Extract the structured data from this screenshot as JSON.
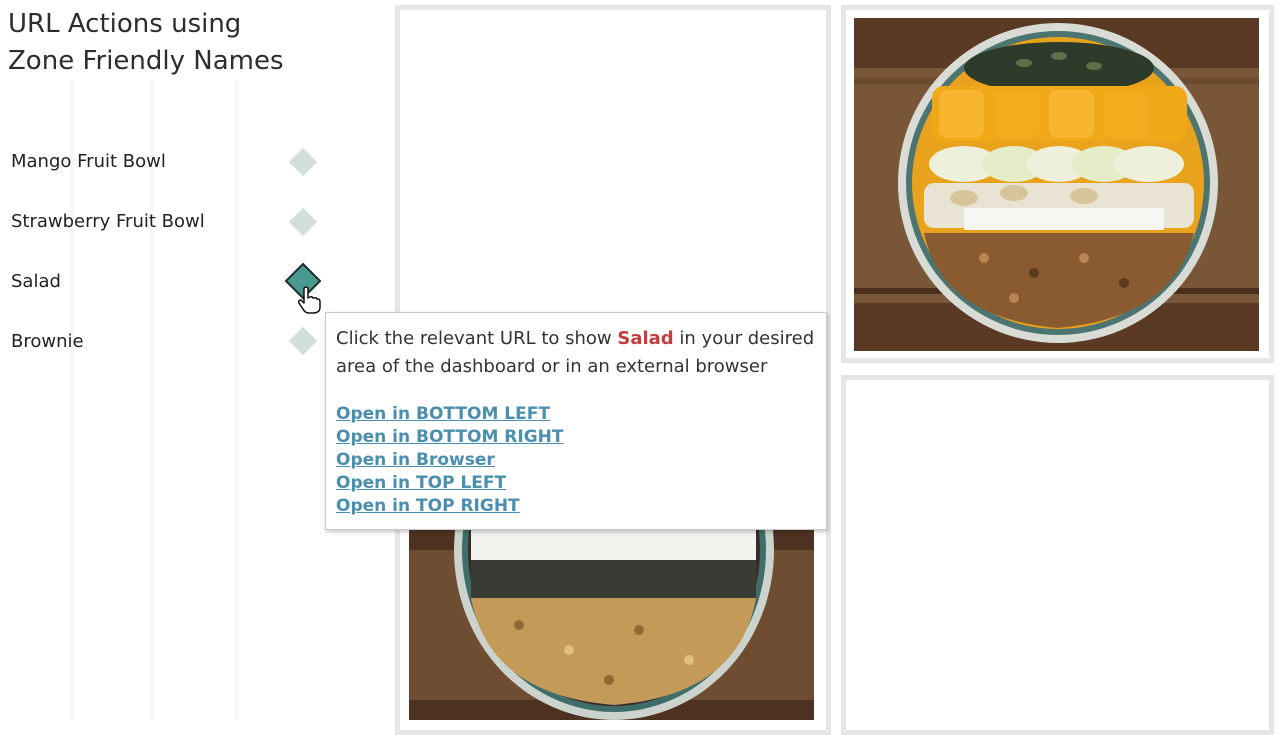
{
  "title": {
    "line1": "URL Actions using",
    "line2": "Zone Friendly Names"
  },
  "items": [
    {
      "label": "Mango Fruit Bowl",
      "selected": false
    },
    {
      "label": "Strawberry Fruit Bowl",
      "selected": false
    },
    {
      "label": "Salad",
      "selected": true
    },
    {
      "label": "Brownie",
      "selected": false
    }
  ],
  "tooltip": {
    "text_before": "Click the relevant URL to show ",
    "highlight": "Salad",
    "text_after": " in your desired area of the dashboard or in an external browser",
    "links": [
      "Open in BOTTOM LEFT",
      "Open in BOTTOM RIGHT",
      "Open in Browser",
      "Open in TOP LEFT",
      "Open in TOP RIGHT"
    ]
  },
  "colors": {
    "accent": "#4a9990",
    "diamond_inactive": "#d3dfdd",
    "link": "#4b8fae",
    "highlight": "#c43d3d"
  },
  "icons": {
    "cursor": "hand-pointer-icon"
  }
}
